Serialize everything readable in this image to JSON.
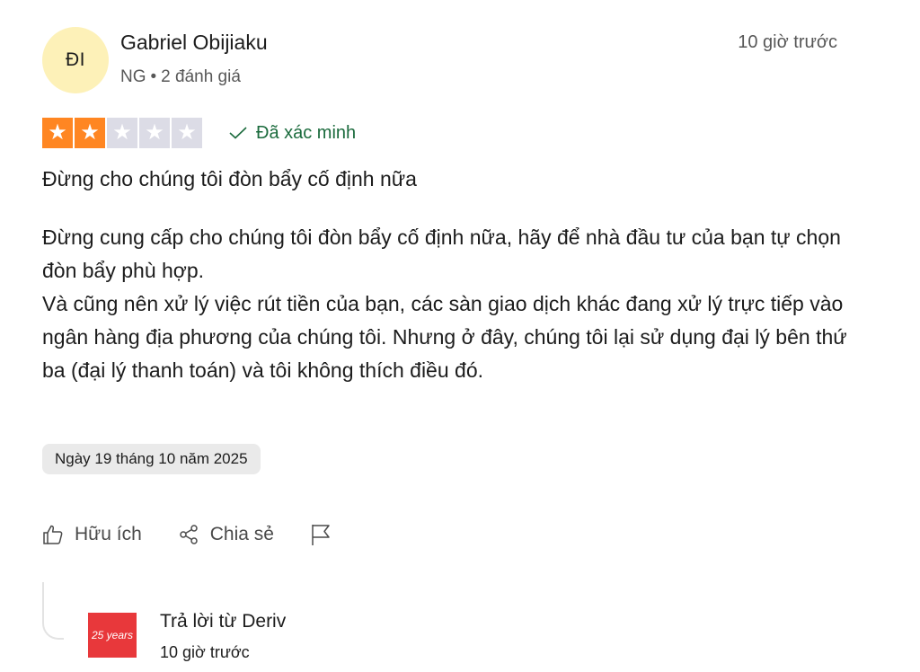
{
  "author": {
    "initials": "ĐI",
    "name": "Gabriel Obijiaku",
    "country": "NG",
    "separator": "•",
    "review_count": "2 đánh giá"
  },
  "timestamp": "10 giờ trước",
  "rating": {
    "value": 2,
    "max": 5,
    "filled_color": "#ff8622",
    "empty_color": "#dcdce6"
  },
  "verified_label": "Đã xác minh",
  "review": {
    "title": "Đừng cho chúng tôi đòn bẩy cố định nữa",
    "paragraphs": [
      "Đừng cung cấp cho chúng tôi đòn bẩy cố định nữa, hãy để nhà đầu tư của bạn tự chọn đòn bẩy phù hợp.",
      "Và cũng nên xử lý việc rút tiền của bạn, các sàn giao dịch khác đang xử lý trực tiếp vào ngân hàng địa phương của chúng tôi. Nhưng ở đây, chúng tôi lại sử dụng đại lý bên thứ ba (đại lý thanh toán) và tôi không thích điều đó."
    ],
    "date": "Ngày 19 tháng 10 năm 2025"
  },
  "actions": {
    "useful_label": "Hữu ích",
    "share_label": "Chia sẻ",
    "flag_icon": "flag-icon"
  },
  "reply": {
    "title": "Trả lời từ Deriv",
    "time": "10 giờ trước",
    "logo": {
      "text": "25 years",
      "color": "#e8383b"
    }
  }
}
